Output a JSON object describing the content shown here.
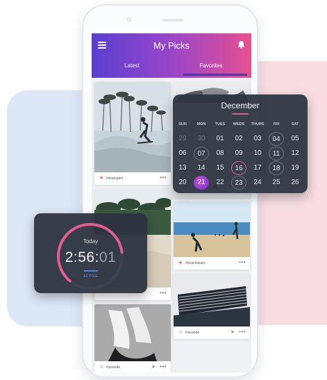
{
  "app": {
    "title": "My Picks",
    "tabs": [
      "Latest",
      "Favorites"
    ],
    "active_tab": "Favorites",
    "accent_gradient": [
      "#5a3fd0",
      "#9a46c9",
      "#e6508f"
    ]
  },
  "feed": [
    {
      "tag": "#skatepark",
      "starred": true
    },
    {
      "tag": "#beachskate",
      "starred": true
    },
    {
      "tag": "#seaside",
      "starred": false
    },
    {
      "tag": "#seaside",
      "starred": false
    }
  ],
  "icons": {
    "menu": "hamburger-icon",
    "notifications": "bell-icon",
    "favorite": "star-icon",
    "share": "send-icon",
    "more": "more-dots-icon"
  },
  "calendar": {
    "month": "December",
    "weekdays": [
      "SUN",
      "MON",
      "TUES",
      "WEDS",
      "THURS",
      "FRI",
      "SAT"
    ],
    "weeks": [
      [
        "29",
        "30",
        "01",
        "02",
        "03",
        "04",
        "05"
      ],
      [
        "06",
        "07",
        "08",
        "09",
        "10",
        "11",
        "12"
      ],
      [
        "13",
        "14",
        "15",
        "16",
        "17",
        "18",
        "19"
      ],
      [
        "20",
        "21",
        "22",
        "23",
        "24",
        "25",
        "26"
      ]
    ],
    "selected_day": "21",
    "today_day": "16",
    "accent_color": "#e35d8f"
  },
  "timer": {
    "label": "Today",
    "time_main": "2:56:",
    "time_dim": "01",
    "status": "ACTIVE",
    "progress": 0.62,
    "track_color": "#e35d8f",
    "status_color": "#5b8ff0"
  }
}
